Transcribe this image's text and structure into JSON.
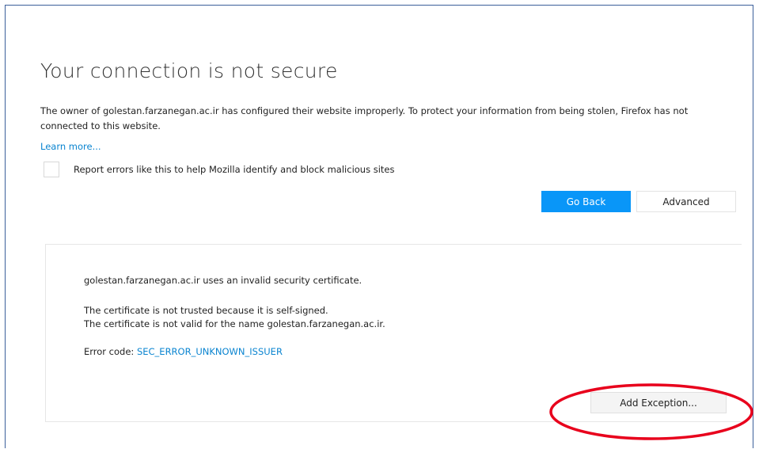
{
  "page": {
    "title": "Your connection is not secure",
    "description": "The owner of golestan.farzanegan.ac.ir has configured their website improperly. To protect your information from being stolen, Firefox has not connected to this website.",
    "learn_more": "Learn more...",
    "report_label": "Report errors like this to help Mozilla identify and block malicious sites",
    "report_checked": false
  },
  "buttons": {
    "go_back": "Go Back",
    "advanced": "Advanced",
    "add_exception": "Add Exception..."
  },
  "details": {
    "line1": "golestan.farzanegan.ac.ir uses an invalid security certificate.",
    "line2": "The certificate is not trusted because it is self-signed.",
    "line3": "The certificate is not valid for the name golestan.farzanegan.ac.ir.",
    "error_code_label": "Error code: ",
    "error_code": "SEC_ERROR_UNKNOWN_ISSUER"
  },
  "colors": {
    "accent_blue": "#0996f8",
    "link_blue": "#0a84d0",
    "highlight_red": "#e8001c"
  }
}
